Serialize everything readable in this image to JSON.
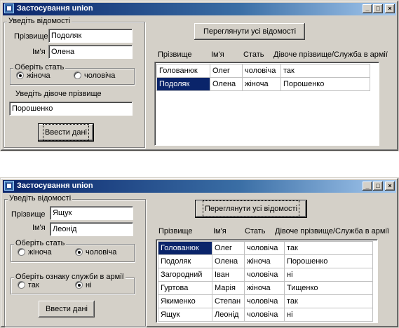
{
  "window1": {
    "title": "Застосування union",
    "controls": {
      "minimize": "_",
      "maximize": "□",
      "close": "×"
    },
    "input_group_label": "Уведіть відомості",
    "surname_label": "Прізвище",
    "surname_value": "Подоляк",
    "name_label": "Ім'я",
    "name_value": "Олена",
    "gender_group_label": "Оберіть стать",
    "gender_female": "жіноча",
    "gender_male": "чоловіча",
    "maiden_prompt": "Уведіть дівоче прізвище",
    "maiden_value": "Порошенко",
    "submit_button": "Ввести дані",
    "view_all_button": "Переглянути усі відомості",
    "columns": [
      "Прізвище",
      "Ім'я",
      "Стать",
      "Дівоче прізвище/Служба в армії"
    ],
    "rows": [
      [
        "Голованюк",
        "Олег",
        "чоловіча",
        "так"
      ],
      [
        "Подоляк",
        "Олена",
        "жіноча",
        "Порошенко"
      ]
    ]
  },
  "window2": {
    "title": "Застосування union",
    "controls": {
      "minimize": "_",
      "maximize": "□",
      "close": "×"
    },
    "input_group_label": "Уведіть відомості",
    "surname_label": "Прізвище",
    "surname_value": "Ящук",
    "name_label": "Ім'я",
    "name_value": "Леонід",
    "gender_group_label": "Оберіть стать",
    "gender_female": "жіноча",
    "gender_male": "чоловіча",
    "army_group_label": "Оберіть ознаку служби в армії",
    "army_yes": "так",
    "army_no": "ні",
    "submit_button": "Ввести дані",
    "view_all_button": "Переглянути усі відомості",
    "columns": [
      "Прізвище",
      "Ім'я",
      "Стать",
      "Дівоче прізвище/Служба в армії"
    ],
    "rows": [
      [
        "Голованюк",
        "Олег",
        "чоловіча",
        "так"
      ],
      [
        "Подоляк",
        "Олена",
        "жіноча",
        "Порошенко"
      ],
      [
        "Загородний",
        "Іван",
        "чоловіча",
        "ні"
      ],
      [
        "Гуртова",
        "Марія",
        "жіноча",
        "Тищенко"
      ],
      [
        "Якименко",
        "Степан",
        "чоловіча",
        "так"
      ],
      [
        "Ящук",
        "Леонід",
        "чоловіча",
        "ні"
      ]
    ]
  }
}
